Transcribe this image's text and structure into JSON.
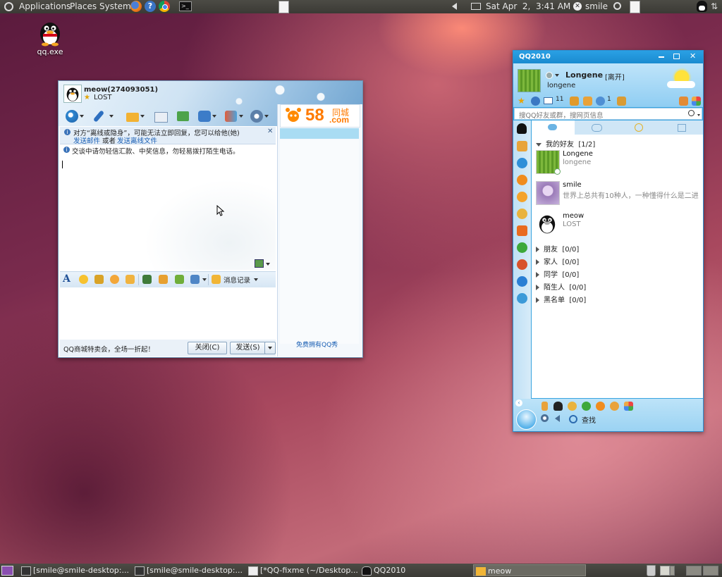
{
  "top_panel": {
    "applications": "Applications",
    "places": "Places",
    "system": "System",
    "datetime": "Sat Apr  2,  3:41 AM",
    "user": "smile"
  },
  "desktop": {
    "icon_label": "qq.exe"
  },
  "chat_window": {
    "contact_title": "meow(274093051)",
    "contact_status": "LOST",
    "notice_line1": "对方“离线或隐身”，可能无法立即回复，您可以给他(她)",
    "notice_link1": "发送邮件",
    "notice_mid": "或者",
    "notice_link2": "发送离线文件",
    "warning": "交谈中请勿轻信汇款、中奖信息，勿轻易拨打陌生电话。",
    "msg_history": "消息记录",
    "ad_text": "QQ商城特卖会，全场一折起！",
    "close_btn": "关闭(C)",
    "send_btn": "发送(S)",
    "side_logo_58": "58",
    "side_logo_com": ".com",
    "side_logo_cn": "同城",
    "side_bottom": "免费拥有QQ秀"
  },
  "qq_window": {
    "title": "QQ2010",
    "nickname": "Longene",
    "status": "[离开]",
    "signature": "longene",
    "mail_count": "11",
    "alt_count": "1",
    "search_placeholder": "搜QQ好友或群，搜网页信息",
    "groups": [
      {
        "name": "我的好友",
        "count": "[1/2]"
      },
      {
        "name": "朋友",
        "count": "[0/0]"
      },
      {
        "name": "家人",
        "count": "[0/0]"
      },
      {
        "name": "同学",
        "count": "[0/0]"
      },
      {
        "name": "陌生人",
        "count": "[0/0]"
      },
      {
        "name": "黑名单",
        "count": "[0/0]"
      }
    ],
    "contacts": [
      {
        "name": "Longene",
        "status": "longene"
      },
      {
        "name": "smile",
        "status": "世界上总共有10种人，一种懂得什么是二进"
      },
      {
        "name": "meow",
        "status": "LOST"
      }
    ],
    "search_btn": "查找"
  },
  "taskbar": {
    "tasks": [
      "[smile@smile-desktop:...",
      "[smile@smile-desktop:...",
      "[*QQ-fixme (~/Desktop...",
      "QQ2010",
      "meow"
    ]
  }
}
